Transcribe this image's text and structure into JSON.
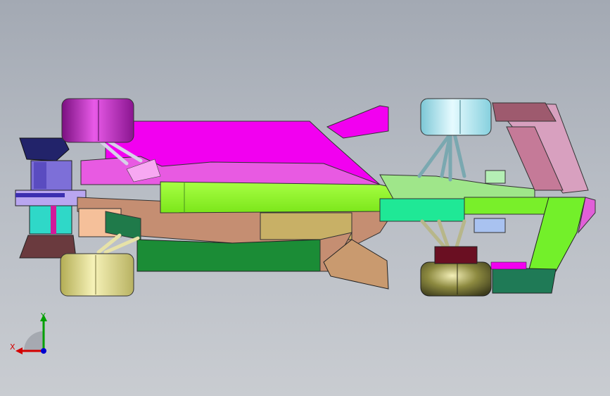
{
  "viewport": {
    "background_top": "#a3a9b3",
    "background_bottom": "#c9ccd1"
  },
  "model": {
    "description_icon": "car-assembly-top-view",
    "part_colors": {
      "magenta": "#f200f0",
      "lime": "#88ff22",
      "green": "#1f8a3c",
      "tan": "#b88c6e",
      "cyan": "#8fe6f2",
      "olive": "#d7d27a",
      "purple": "#9a1c8f",
      "pink": "#d9a3c8",
      "mint": "#5fe0a0"
    }
  },
  "triad": {
    "x_label": "X",
    "y_label": "Y",
    "x_color": "#d40000",
    "y_color": "#00a000",
    "z_color": "#0000d0"
  }
}
